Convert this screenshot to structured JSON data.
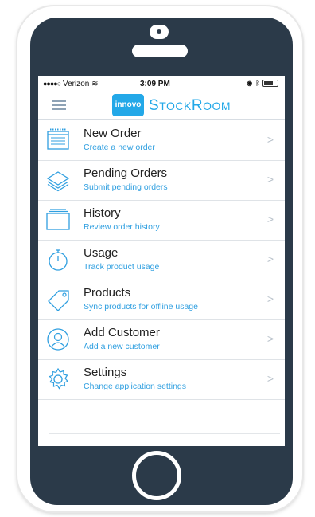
{
  "status_bar": {
    "carrier": "Verizon",
    "time": "3:09 PM"
  },
  "header": {
    "logo_text": "innovo",
    "app_name_first": "S",
    "app_name_rest_1": "TOCK",
    "app_name_second": "R",
    "app_name_rest_2": "OOM"
  },
  "menu": {
    "items": [
      {
        "label": "New Order",
        "sub": "Create a new order",
        "icon": "order-form-icon"
      },
      {
        "label": "Pending Orders",
        "sub": "Submit pending orders",
        "icon": "stack-icon"
      },
      {
        "label": "History",
        "sub": "Review order history",
        "icon": "folder-icon"
      },
      {
        "label": "Usage",
        "sub": "Track product usage",
        "icon": "stopwatch-icon"
      },
      {
        "label": "Products",
        "sub": "Sync products for offline usage",
        "icon": "tag-icon"
      },
      {
        "label": "Add Customer",
        "sub": "Add a new customer",
        "icon": "user-icon"
      },
      {
        "label": "Settings",
        "sub": "Change application settings",
        "icon": "gear-icon"
      }
    ],
    "chevron": ">"
  },
  "colors": {
    "accent": "#23a8e8",
    "phone_body": "#2b3a49"
  }
}
